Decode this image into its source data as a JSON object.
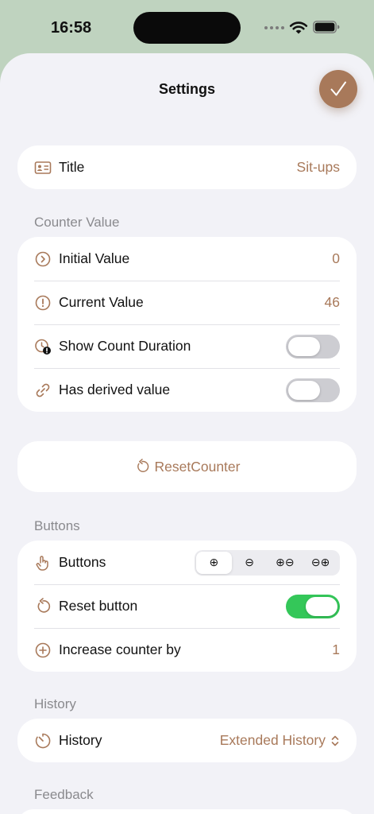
{
  "status": {
    "time": "16:58"
  },
  "nav": {
    "title": "Settings"
  },
  "title_card": {
    "label": "Title",
    "value": "Sit-ups"
  },
  "counter_section": {
    "header": "Counter Value",
    "initial": {
      "label": "Initial Value",
      "value": "0"
    },
    "current": {
      "label": "Current Value",
      "value": "46"
    },
    "show_duration": {
      "label": "Show Count Duration",
      "on": false
    },
    "derived": {
      "label": "Has derived value",
      "on": false
    }
  },
  "reset_card": {
    "label": "ResetCounter"
  },
  "buttons_section": {
    "header": "Buttons",
    "buttons": {
      "label": "Buttons",
      "options": [
        "⊕",
        "⊖",
        "⊕⊖",
        "⊖⊕"
      ],
      "selected": 0
    },
    "reset_button": {
      "label": "Reset button",
      "on": true
    },
    "increase": {
      "label": "Increase counter by",
      "value": "1"
    }
  },
  "history_section": {
    "header": "History",
    "history": {
      "label": "History",
      "value": "Extended History"
    }
  },
  "feedback_section": {
    "header": "Feedback"
  },
  "colors": {
    "accent": "#a8795a",
    "toggle_on": "#34c759",
    "background": "#f2f2f7",
    "header_bg": "#bfd3bf"
  }
}
